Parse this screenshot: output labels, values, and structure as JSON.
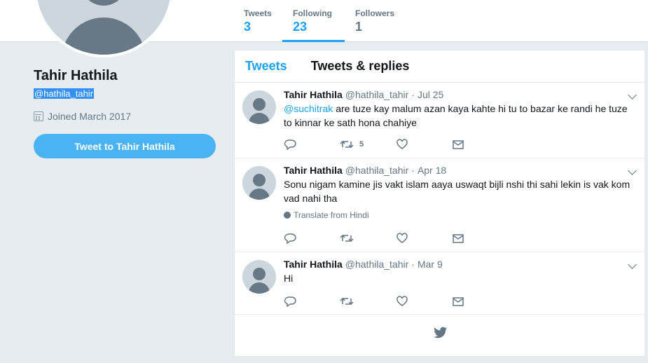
{
  "nav": {
    "stats": [
      {
        "label": "Tweets",
        "value": "3"
      },
      {
        "label": "Following",
        "value": "23"
      },
      {
        "label": "Followers",
        "value": "1"
      }
    ]
  },
  "profile": {
    "name": "Tahir Hathila",
    "handle": "@hathila_tahir",
    "joined": "Joined March 2017",
    "tweet_to_label": "Tweet to Tahir Hathila"
  },
  "timeline": {
    "tabs": [
      "Tweets",
      "Tweets & replies"
    ],
    "tweets": [
      {
        "name": "Tahir Hathila",
        "handle": "@hathila_tahir",
        "sep": "·",
        "date": "Jul 25",
        "mention": "@suchitrak",
        "text": "are tuze kay malum azan kaya kahte hi tu to bazar ke randi he tuze to kinnar ke sath hona chahiye",
        "retweets": "5"
      },
      {
        "name": "Tahir Hathila",
        "handle": "@hathila_tahir",
        "sep": "·",
        "date": "Apr 18",
        "text": "Sonu nigam kamine jis vakt islam aaya uswaqt bijli nshi thi sahi lekin is vak kom vad nahi tha",
        "translate": "Translate from Hindi"
      },
      {
        "name": "Tahir Hathila",
        "handle": "@hathila_tahir",
        "sep": "·",
        "date": "Mar 9",
        "text": "Hi"
      }
    ]
  },
  "colors": {
    "accent": "#1da1f2",
    "button": "#4ab3f4",
    "muted": "#657786",
    "background": "#e6ecf0"
  },
  "icons": [
    "calendar-icon",
    "reply-icon",
    "retweet-icon",
    "like-icon",
    "message-icon",
    "chevron-down-icon",
    "globe-icon",
    "twitter-bird-icon"
  ]
}
